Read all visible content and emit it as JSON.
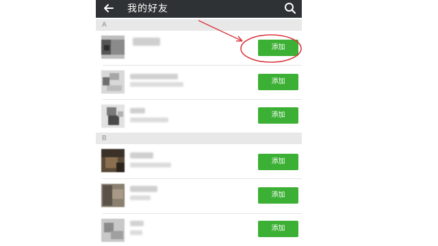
{
  "header": {
    "back_icon": "arrow-left-icon",
    "title": "我的好友",
    "search_icon": "search-icon"
  },
  "sections": [
    {
      "letter": "A",
      "contacts": [
        {
          "add_label": "添加"
        },
        {
          "add_label": "添加"
        },
        {
          "add_label": "添加"
        }
      ]
    },
    {
      "letter": "B",
      "contacts": [
        {
          "add_label": "添加"
        },
        {
          "add_label": "添加"
        },
        {
          "add_label": "添加"
        }
      ]
    }
  ],
  "colors": {
    "topbar": "#2f3234",
    "add_button": "#3cb034",
    "annotation": "#d9363e"
  }
}
